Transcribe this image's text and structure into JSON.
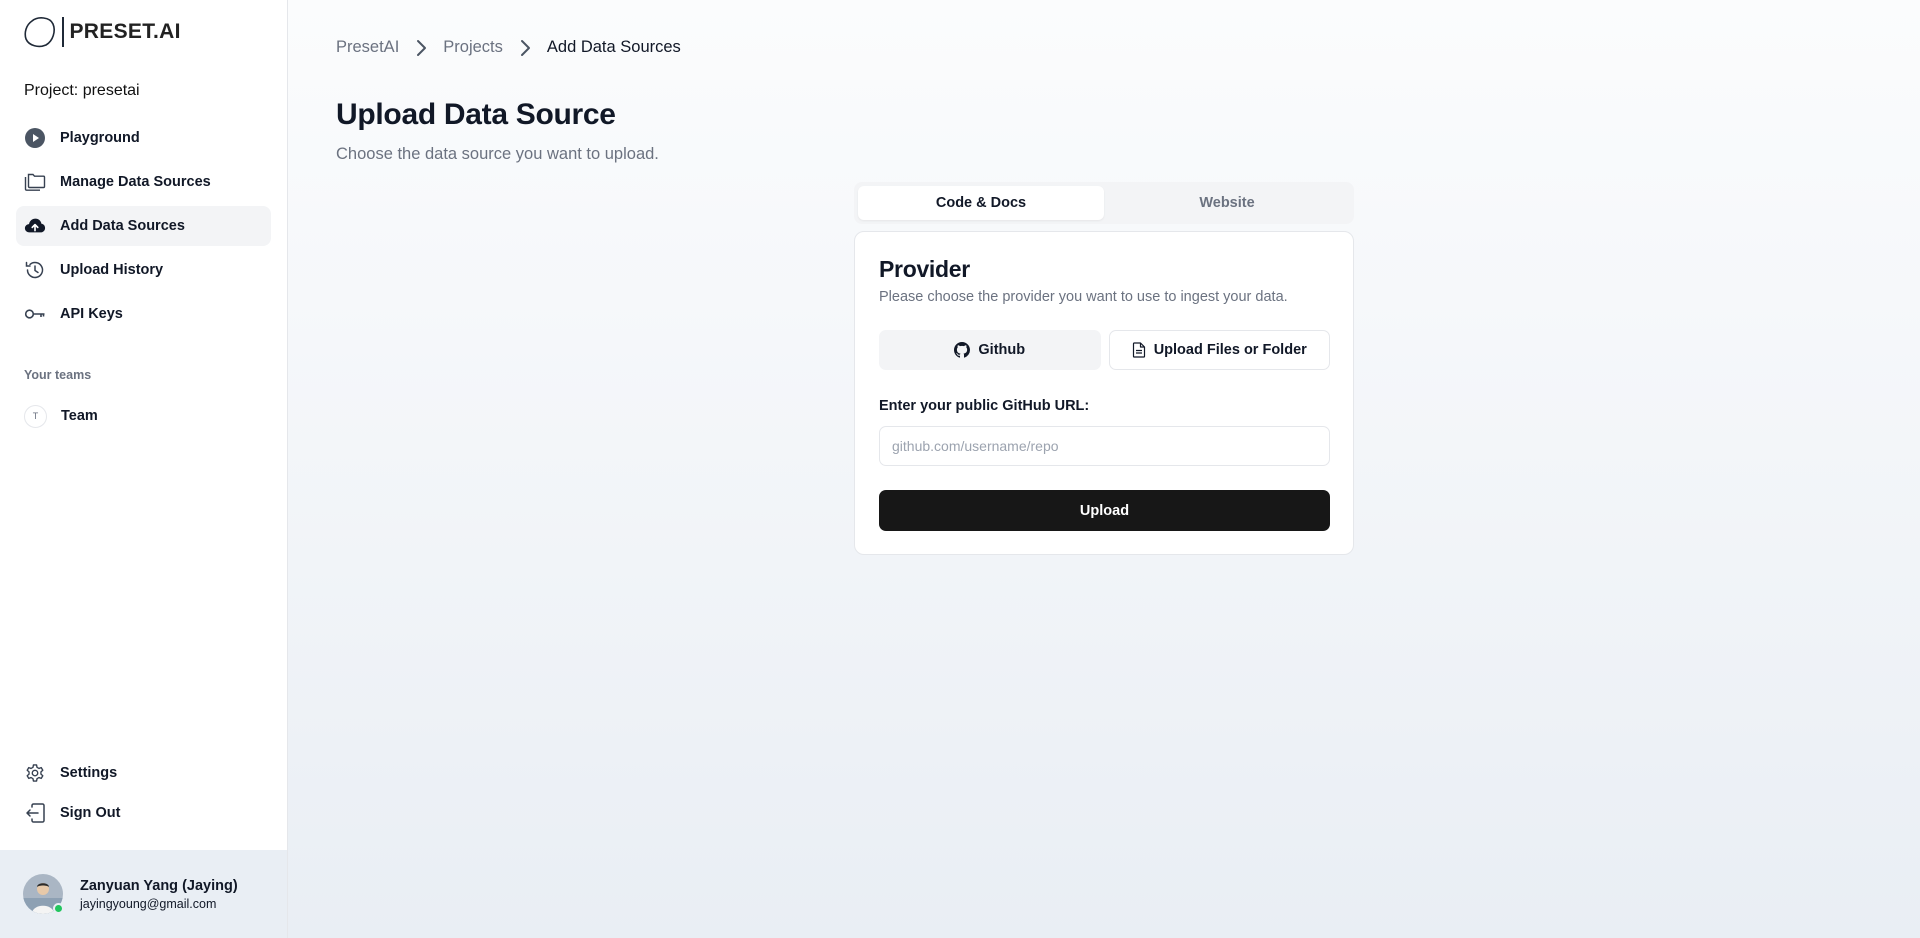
{
  "brand": {
    "name": "PRESET.AI"
  },
  "project": {
    "label": "Project: presetai"
  },
  "sidebar": {
    "items": [
      {
        "label": "Playground",
        "icon": "play-circle-icon",
        "active": false
      },
      {
        "label": "Manage Data Sources",
        "icon": "folders-icon",
        "active": false
      },
      {
        "label": "Add Data Sources",
        "icon": "cloud-upload-icon",
        "active": true
      },
      {
        "label": "Upload History",
        "icon": "history-icon",
        "active": false
      },
      {
        "label": "API Keys",
        "icon": "key-icon",
        "active": false
      }
    ],
    "teams_heading": "Your teams",
    "team": {
      "initial": "T",
      "label": "Team"
    },
    "bottom_items": [
      {
        "label": "Settings",
        "icon": "gear-icon"
      },
      {
        "label": "Sign Out",
        "icon": "sign-out-icon"
      }
    ]
  },
  "user": {
    "name": "Zanyuan Yang (Jaying)",
    "email": "jayingyoung@gmail.com",
    "status_color": "#22c55e"
  },
  "breadcrumb": [
    "PresetAI",
    "Projects",
    "Add Data Sources"
  ],
  "page": {
    "title": "Upload Data Source",
    "subtitle": "Choose the data source you want to upload."
  },
  "tabs": [
    {
      "label": "Code & Docs",
      "active": true
    },
    {
      "label": "Website",
      "active": false
    }
  ],
  "provider": {
    "title": "Provider",
    "description": "Please choose the provider you want to use to ingest your data.",
    "github_label": "Github",
    "upload_label": "Upload Files or Folder",
    "url_label": "Enter your public GitHub URL:",
    "url_placeholder": "github.com/username/repo",
    "url_value": "",
    "submit_label": "Upload"
  },
  "colors": {
    "accent": "#171717",
    "active_bg": "#f3f4f6",
    "muted_text": "#6b7280"
  }
}
